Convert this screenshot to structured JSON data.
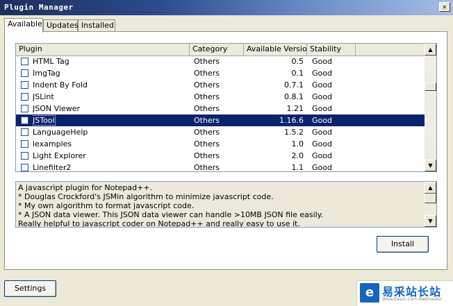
{
  "window": {
    "title": "Plugin Manager",
    "close_glyph": "✕"
  },
  "tabs": [
    {
      "label": "Available",
      "active": true
    },
    {
      "label": "Updates",
      "active": false
    },
    {
      "label": "Installed",
      "active": false
    }
  ],
  "table": {
    "columns": [
      "Plugin",
      "Category",
      "Available Version",
      "Stability"
    ],
    "rows": [
      {
        "name": "HTML Tag",
        "category": "Others",
        "version": "0.5",
        "stability": "Good",
        "selected": false
      },
      {
        "name": "ImgTag",
        "category": "Others",
        "version": "0.1",
        "stability": "Good",
        "selected": false
      },
      {
        "name": "Indent By Fold",
        "category": "Others",
        "version": "0.7.1",
        "stability": "Good",
        "selected": false
      },
      {
        "name": "JSLint",
        "category": "Others",
        "version": "0.8.1",
        "stability": "Good",
        "selected": false
      },
      {
        "name": "JSON Viewer",
        "category": "Others",
        "version": "1.21",
        "stability": "Good",
        "selected": false
      },
      {
        "name": "JSTool",
        "category": "Others",
        "version": "1.16.6",
        "stability": "Good",
        "selected": true
      },
      {
        "name": "LanguageHelp",
        "category": "Others",
        "version": "1.5.2",
        "stability": "Good",
        "selected": false
      },
      {
        "name": "lexamples",
        "category": "Others",
        "version": "1.0",
        "stability": "Good",
        "selected": false
      },
      {
        "name": "Light Explorer",
        "category": "Others",
        "version": "2.0",
        "stability": "Good",
        "selected": false
      },
      {
        "name": "Linefilter2",
        "category": "Others",
        "version": "1.1",
        "stability": "Good",
        "selected": false
      }
    ]
  },
  "description": {
    "lines": [
      "A javascript plugin for Notepad++.",
      " * Douglas Crockford's JSMin algorithm to minimize javascript code.",
      " * My own algorithm to format javascript code.",
      " * A JSON data viewer. This JSON data viewer can handle >10MB JSON file easily.",
      "Really helpful to javascript coder on Notepad++ and really easy to use it."
    ]
  },
  "buttons": {
    "install": "Install",
    "settings": "Settings"
  },
  "scroll": {
    "up_glyph": "▲",
    "down_glyph": "▼"
  },
  "watermark": {
    "logo": "e",
    "title": "易采站长站",
    "subtitle": "Www.Easck.Com  Webmaster"
  },
  "colors": {
    "selection": "#0a246a",
    "titlebar": "#2d4a8c",
    "watermark": "#1565c0"
  }
}
